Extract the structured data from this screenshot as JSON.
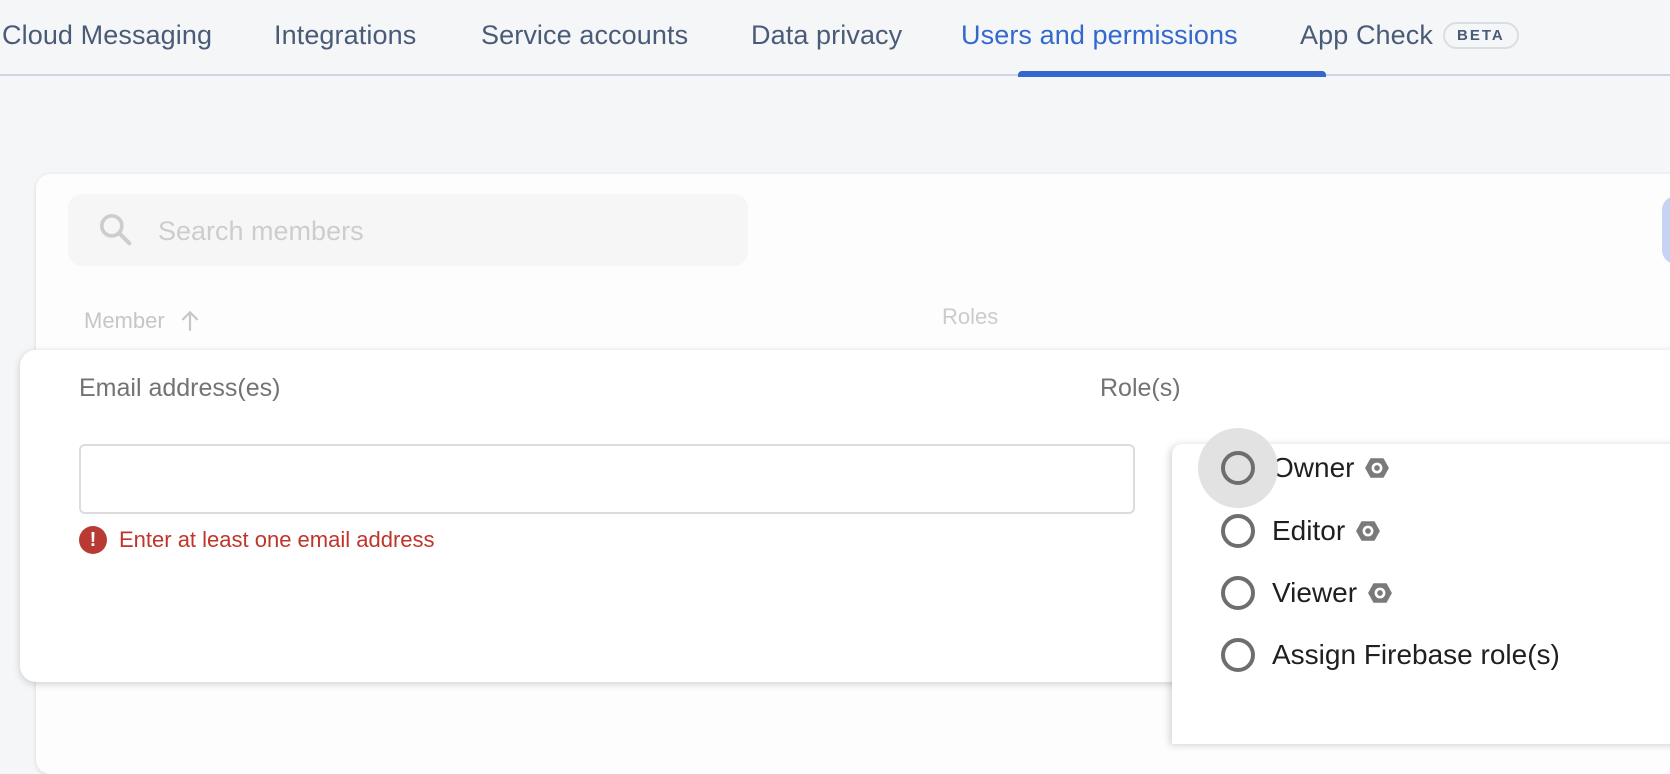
{
  "tabs": [
    {
      "label": "Cloud Messaging",
      "active": false
    },
    {
      "label": "Integrations",
      "active": false
    },
    {
      "label": "Service accounts",
      "active": false
    },
    {
      "label": "Data privacy",
      "active": false
    },
    {
      "label": "Users and permissions",
      "active": true
    },
    {
      "label": "App Check",
      "active": false,
      "badge": "BETA"
    }
  ],
  "colors": {
    "accent": "#3468cc",
    "error": "#c0352b",
    "tab_text": "#4a5b78"
  },
  "members": {
    "search": {
      "placeholder": "Search members",
      "value": "",
      "icon": "search-icon"
    },
    "columns": {
      "member": "Member",
      "member_sort": "ascending",
      "roles": "Roles"
    }
  },
  "add_member": {
    "email_label": "Email address(es)",
    "email_value": "",
    "email_error": "Enter at least one email address",
    "roles_label": "Role(s)",
    "role_options": [
      {
        "label": "Owner",
        "selected": false,
        "iam_icon": true,
        "focused": true
      },
      {
        "label": "Editor",
        "selected": false,
        "iam_icon": true
      },
      {
        "label": "Viewer",
        "selected": false,
        "iam_icon": true
      },
      {
        "label": "Assign Firebase role(s)",
        "selected": false,
        "iam_icon": false
      }
    ]
  }
}
